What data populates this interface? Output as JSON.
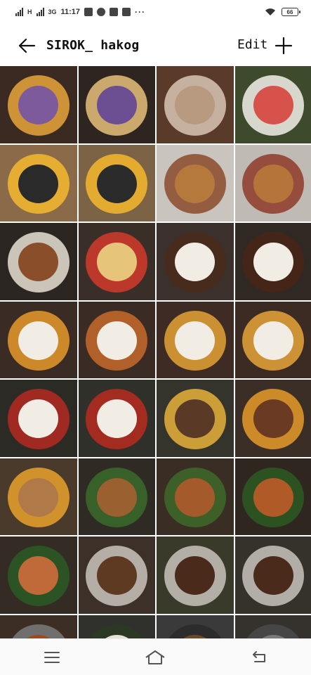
{
  "status_bar": {
    "network_1": "H",
    "network_2": "3G",
    "time": "11:17",
    "more": "···",
    "battery": "66"
  },
  "header": {
    "title": "SIROK_ hakog",
    "edit_label": "Edit"
  },
  "grid": {
    "columns": 4,
    "rows": 8,
    "tiles": [
      {
        "bg": "#3a2a22",
        "accent": "#7d5a9c",
        "secondary": "#e8a63a"
      },
      {
        "bg": "#2e2420",
        "accent": "#6c4e93",
        "secondary": "#e6c07a"
      },
      {
        "bg": "#5a3a28",
        "accent": "#b89a80",
        "secondary": "#d9c7b5"
      },
      {
        "bg": "#3d4a2c",
        "accent": "#d6524a",
        "secondary": "#f2f0ea"
      },
      {
        "bg": "#8a6a48",
        "accent": "#2a2a2a",
        "secondary": "#f5b82e"
      },
      {
        "bg": "#7d6346",
        "accent": "#2b2b2b",
        "secondary": "#f5b82e"
      },
      {
        "bg": "#c9c4bd",
        "accent": "#b6793c",
        "secondary": "#8b4a2a"
      },
      {
        "bg": "#bfbab3",
        "accent": "#b5743a",
        "secondary": "#8e3a28"
      },
      {
        "bg": "#2c2622",
        "accent": "#8a4e2a",
        "secondary": "#e8e0d2"
      },
      {
        "bg": "#3a2e28",
        "accent": "#e6c47a",
        "secondary": "#d23a2a"
      },
      {
        "bg": "#3b302b",
        "accent": "#f1ede4",
        "secondary": "#4a2a1a"
      },
      {
        "bg": "#302823",
        "accent": "#f1ede4",
        "secondary": "#4a2418"
      },
      {
        "bg": "#3a2c25",
        "accent": "#f1ede4",
        "secondary": "#e79a2a"
      },
      {
        "bg": "#3a2c24",
        "accent": "#f1ede4",
        "secondary": "#c86a2a"
      },
      {
        "bg": "#3e2c24",
        "accent": "#f1ede4",
        "secondary": "#e4a235"
      },
      {
        "bg": "#3b2b22",
        "accent": "#f1ede4",
        "secondary": "#e7a33a"
      },
      {
        "bg": "#2c2a24",
        "accent": "#f1ede4",
        "secondary": "#b52a22"
      },
      {
        "bg": "#30302a",
        "accent": "#f1ede4",
        "secondary": "#b82a1e"
      },
      {
        "bg": "#35342c",
        "accent": "#5a3a26",
        "secondary": "#e5b23a"
      },
      {
        "bg": "#3a2e26",
        "accent": "#6a3a22",
        "secondary": "#e89a2a"
      },
      {
        "bg": "#4a3a2c",
        "accent": "#b07a48",
        "secondary": "#e9a22c"
      },
      {
        "bg": "#2f2a24",
        "accent": "#9a6030",
        "secondary": "#3a6a2a"
      },
      {
        "bg": "#3a2d24",
        "accent": "#a55a2c",
        "secondary": "#3e6a2a"
      },
      {
        "bg": "#302620",
        "accent": "#b05a28",
        "secondary": "#2d5a22"
      },
      {
        "bg": "#352b25",
        "accent": "#c06a3a",
        "secondary": "#2a5a24"
      },
      {
        "bg": "#3c3029",
        "accent": "#5e3a22",
        "secondary": "#c9c4bd"
      },
      {
        "bg": "#3a3a2a",
        "accent": "#4a2a1a",
        "secondary": "#c9c4bd"
      },
      {
        "bg": "#34322a",
        "accent": "#4a2a1a",
        "secondary": "#c9c4bd"
      },
      {
        "bg": "#3c2e24",
        "accent": "#a0481e",
        "secondary": "#7a7a7a"
      },
      {
        "bg": "#30302c",
        "accent": "#e8e2d4",
        "secondary": "#2a3a22"
      },
      {
        "bg": "#3a3a3a",
        "accent": "#6a4a2a",
        "secondary": "#2a2a2a"
      },
      {
        "bg": "#35322e",
        "accent": "#7a7a7a",
        "secondary": "#4a4a4a"
      }
    ]
  }
}
